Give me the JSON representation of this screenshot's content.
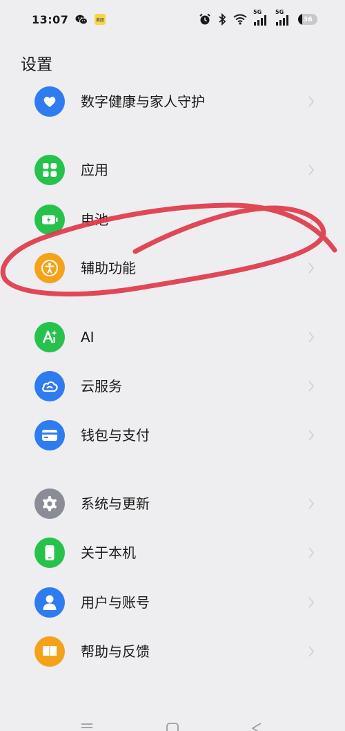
{
  "status_bar": {
    "time": "13:07",
    "left_icons": [
      "wechat-icon",
      "meituan-icon"
    ],
    "meituan_text": "美团",
    "right_icons": [
      "alarm-icon",
      "bluetooth-icon",
      "wifi-icon",
      "signal-5g-icon",
      "signal-5g-icon",
      "battery-icon"
    ],
    "network_1": "5G",
    "network_2": "5G",
    "battery_level": "36"
  },
  "page": {
    "title": "设置"
  },
  "settings_items": [
    {
      "label": "数字健康与家人守护",
      "icon": "heart-shield-icon",
      "color": "#2f7cf0"
    },
    {
      "label": "应用",
      "icon": "apps-grid-icon",
      "color": "#27c24c"
    },
    {
      "label": "电池",
      "icon": "battery-charging-icon",
      "color": "#27c24c"
    },
    {
      "label": "辅助功能",
      "icon": "accessibility-icon",
      "color": "#f5a21b"
    },
    {
      "label": "AI",
      "icon": "ai-sparkle-icon",
      "color": "#27c24c"
    },
    {
      "label": "云服务",
      "icon": "cloud-icon",
      "color": "#2f7cf0"
    },
    {
      "label": "钱包与支付",
      "icon": "wallet-card-icon",
      "color": "#2f7cf0"
    },
    {
      "label": "系统与更新",
      "icon": "gear-icon",
      "color": "#8a8d96"
    },
    {
      "label": "关于本机",
      "icon": "phone-icon",
      "color": "#27c24c"
    },
    {
      "label": "用户与账号",
      "icon": "user-icon",
      "color": "#2f7cf0"
    },
    {
      "label": "帮助与反馈",
      "icon": "help-book-icon",
      "color": "#f5a21b"
    }
  ],
  "navigation_bar": {
    "buttons": [
      "menu-icon",
      "home-icon",
      "back-icon"
    ]
  },
  "annotation": {
    "color": "#e03a4a",
    "target": "辅助功能"
  }
}
